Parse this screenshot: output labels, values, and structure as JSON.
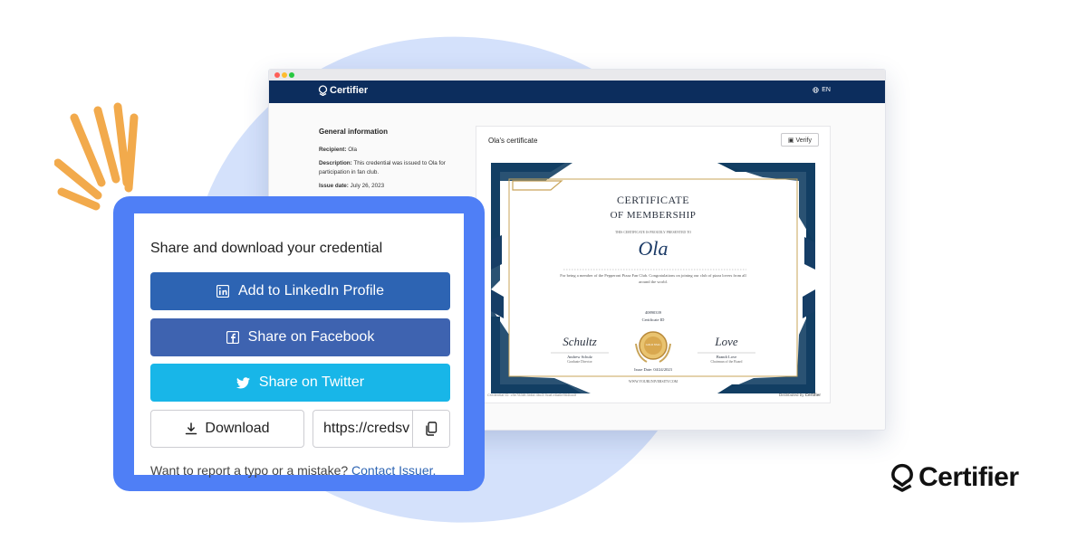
{
  "browser": {
    "brand": "Certifier",
    "lang": "EN",
    "general_info": {
      "heading": "General information",
      "recipient_label": "Recipient:",
      "recipient_value": "Ola",
      "description_label": "Description:",
      "description_value": "This credential was issued to Ola for participation in fan club.",
      "issue_label": "Issue date:",
      "issue_value": "July 26, 2023"
    },
    "panel_title": "Ola's certificate",
    "verify_label": "Verify",
    "certificate": {
      "title_line1": "CERTIFICATE",
      "title_line2": "OF MEMBERSHIP",
      "presented": "THIS CERTIFICATE IS PROUDLY PRESENTED TO",
      "name": "Ola",
      "body": "For being a member of the Pepperoni Pizza Fan Club. Congratulations on joining our club of pizza lovers from all around the world.",
      "cert_id_value": "40890339",
      "cert_id_label": "Certificate ID",
      "sig_left_script": "Schultz",
      "sig_left_name": "Andrew Schulz",
      "sig_left_role": "Graduate Director",
      "sig_right_script": "Love",
      "sig_right_name": "Brandi Love",
      "sig_right_role": "Chairman of the Board",
      "issue_date": "Issue Date: 04/24/2023",
      "website": "WWW.YOURUNIVERSITY.COM",
      "seal_text": "GOLD SEAL"
    },
    "credential_id": "Credential ID: c9e7838f-3b6d-4bc3-9caf-e6a6e964ba4f",
    "distributed_by": "Distributed by"
  },
  "share": {
    "title": "Share and download your credential",
    "linkedin": "Add to LinkedIn Profile",
    "facebook": "Share on Facebook",
    "twitter": "Share on Twitter",
    "download": "Download",
    "url_value": "https://credsv",
    "report_text": "Want to report a typo or a mistake?",
    "contact_link": "Contact Issuer."
  },
  "brand_large": "Certifier",
  "colors": {
    "navy": "#0c2d5d",
    "card_blue": "#4f7ff6",
    "linkedin": "#2d64b3",
    "facebook": "#3e63b0",
    "twitter": "#18b6e8",
    "accent_orange": "#f2aa4c"
  }
}
